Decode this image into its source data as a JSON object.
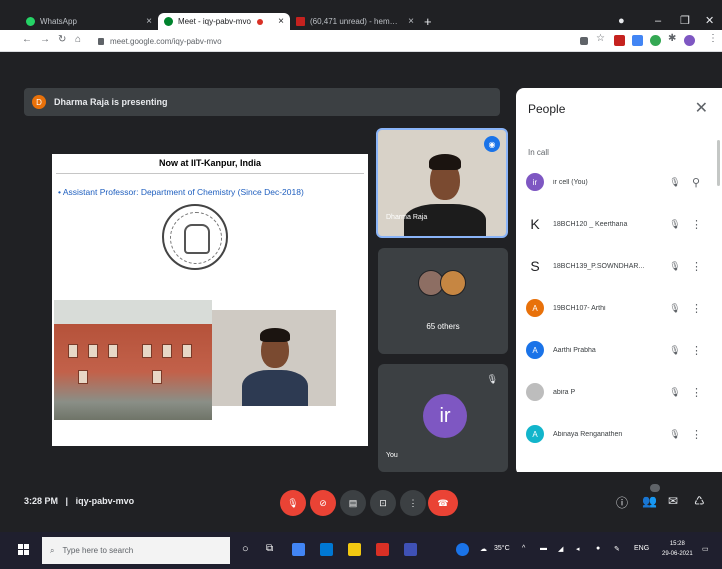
{
  "browser": {
    "tabs": [
      {
        "label": "WhatsApp",
        "color": "#25d366"
      },
      {
        "label": "Meet - iqy-pabv-mvo",
        "color": "#00832d"
      },
      {
        "label": "(60,471 unread) - hemamalini2...",
        "color": "#c5221f"
      }
    ],
    "new_tab": "+",
    "url": "meet.google.com/iqy-pabv-mvo",
    "window_controls": {
      "minimize": "–",
      "maximize": "❐",
      "close": "✕"
    }
  },
  "meet": {
    "presenter_initial": "D",
    "presenter_banner": "Dharma Raja is presenting",
    "slide": {
      "title": "Now at IIT-Kanpur, India",
      "bullet": "Assistant Professor: Department of Chemistry (Since Dec-2018)"
    },
    "tiles": {
      "main_name": "Dharma Raja",
      "others_label": "65 others",
      "you_initial": "ir",
      "you_label": "You"
    },
    "meeting_time": "3:28 PM",
    "separator": "|",
    "meeting_code": "iqy-pabv-mvo"
  },
  "people_panel": {
    "title": "People",
    "section": "In call",
    "participants": [
      {
        "name": "ir cell (You)",
        "initial": "ir",
        "color": "#7e57c2"
      },
      {
        "name": "18BCH120 _ Keerthana",
        "initial": "K",
        "color": "#ffffff"
      },
      {
        "name": "18BCH139_P.SOWNDHAR...",
        "initial": "S",
        "color": "#ffffff"
      },
      {
        "name": "19BCH107- Arthi",
        "initial": "A",
        "color": "#e8710a"
      },
      {
        "name": "Aarthi Prabha",
        "initial": "A",
        "color": "#1a73e8"
      },
      {
        "name": "abira P",
        "initial": "",
        "color": "#bdbdbd"
      },
      {
        "name": "Abinaya Renganathen",
        "initial": "A",
        "color": "#12b5cb"
      }
    ]
  },
  "taskbar": {
    "search_placeholder": "Type here to search",
    "weather": "35°C",
    "language": "ENG",
    "time": "15:28",
    "date": "29-06-2021"
  },
  "colors": {
    "meet_dark": "#202124",
    "tile": "#3c4043",
    "accent_blue": "#8ab4f8",
    "danger_red": "#ea4335",
    "slide_blue_text": "#1f5fbf"
  }
}
